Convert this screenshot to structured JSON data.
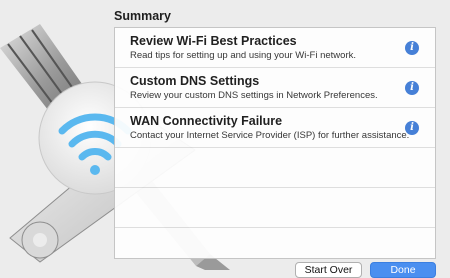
{
  "summary": {
    "title": "Summary"
  },
  "items": [
    {
      "title": "Review Wi-Fi Best Practices",
      "description": "Read tips for setting up and using your Wi-Fi network."
    },
    {
      "title": "Custom DNS Settings",
      "description": "Review your custom DNS settings in Network Preferences."
    },
    {
      "title": "WAN Connectivity Failure",
      "description": "Contact your Internet Service Provider (ISP) for further assistance."
    }
  ],
  "info_icon_glyph": "i",
  "buttons": {
    "start_over": "Start Over",
    "done": "Done"
  },
  "icons": {
    "wifi": "wifi-icon",
    "screwdriver": "screwdriver-icon",
    "wrench": "wrench-icon",
    "info": "info-icon"
  },
  "colors": {
    "wifi_blue": "#5ab8ef",
    "info_blue": "#3a78d6",
    "done_blue": "#4a8ff0"
  }
}
